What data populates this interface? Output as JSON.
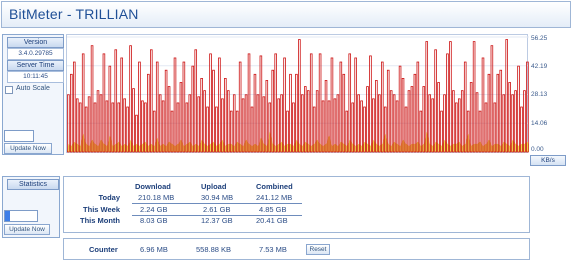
{
  "window": {
    "title": "BitMeter - TRILLIAN"
  },
  "sidebar": {
    "version_label": "Version",
    "version_value": "3.4.0.29785",
    "server_time_label": "Server Time",
    "server_time_value": "10:11:45",
    "auto_scale_label": "Auto Scale",
    "auto_scale_checked": false,
    "update_now_label": "Update Now",
    "progress_fraction": 0.0
  },
  "stats_sidebar": {
    "statistics_label": "Statistics",
    "update_now_label": "Update Now",
    "progress_fraction": 0.15
  },
  "chart_data": {
    "type": "bar",
    "ytick_labels": [
      "56.25",
      "42.19",
      "28.13",
      "14.06",
      "0.00"
    ],
    "ylim": [
      0,
      56.25
    ],
    "units_label": "KB/s",
    "series": [
      {
        "color": "#cc1111",
        "values": [
          28,
          38,
          44,
          26,
          24,
          48,
          22,
          27,
          52,
          24,
          30,
          28,
          48,
          25,
          42,
          24,
          50,
          24,
          46,
          26,
          22,
          52,
          31,
          18,
          44,
          25,
          24,
          38,
          50,
          20,
          44,
          28,
          25,
          40,
          32,
          20,
          46,
          24,
          34,
          44,
          24,
          28,
          42,
          50,
          27,
          36,
          30,
          22,
          48,
          40,
          22,
          46,
          26,
          36,
          30,
          20,
          28,
          20,
          44,
          26,
          28,
          48,
          22,
          38,
          28,
          47,
          27,
          35,
          24,
          40,
          48,
          26,
          28,
          46,
          20,
          38,
          24,
          38,
          55,
          28,
          32,
          30,
          48,
          22,
          30,
          48,
          25,
          35,
          25,
          46,
          26,
          28,
          44,
          38,
          20,
          48,
          24,
          46,
          28,
          25,
          22,
          32,
          47,
          26,
          35,
          28,
          44,
          22,
          40,
          30,
          28,
          25,
          42,
          36,
          22,
          30,
          32,
          38,
          44,
          20,
          32,
          54,
          28,
          26,
          50,
          34,
          20,
          28,
          48,
          54,
          30,
          24,
          26,
          30,
          44,
          20,
          34,
          54,
          29,
          20,
          46,
          24,
          38,
          52,
          24,
          38,
          40,
          28,
          55,
          34,
          28,
          30,
          42,
          22,
          30,
          44
        ]
      },
      {
        "color": "#f0e85a",
        "values": [
          4,
          3,
          5,
          4,
          3,
          9,
          4,
          3,
          6,
          4,
          3,
          6,
          4,
          3,
          8,
          3,
          4,
          5,
          3,
          4,
          3,
          6,
          3,
          4,
          3,
          4,
          5,
          3,
          4,
          3,
          7,
          3,
          4,
          3,
          5,
          4,
          3,
          4,
          6,
          3,
          4,
          5,
          3,
          4,
          3,
          6,
          4,
          3,
          4,
          5,
          3,
          4,
          6,
          3,
          4,
          4,
          3,
          5,
          4,
          3,
          6,
          4,
          3,
          4,
          3,
          7,
          4,
          3,
          10,
          4,
          3,
          4,
          5,
          3,
          4,
          4,
          3,
          6,
          4,
          3,
          5,
          4,
          3,
          4,
          6,
          4,
          3,
          4,
          8,
          3,
          4,
          3,
          5,
          4,
          3,
          6,
          4,
          3,
          4,
          3,
          5,
          4,
          3,
          6,
          4,
          3,
          4,
          9,
          4,
          3,
          5,
          4,
          3,
          6,
          4,
          3,
          4,
          4,
          5,
          3,
          4,
          10,
          4,
          3,
          5,
          4,
          3,
          6,
          4,
          3,
          4,
          4,
          5,
          3,
          4,
          9,
          3,
          4,
          4,
          5,
          3,
          4,
          6,
          3,
          4,
          4,
          3,
          5,
          4,
          3,
          6,
          4,
          3,
          4,
          4,
          5,
          3
        ]
      }
    ]
  },
  "stats": {
    "columns": [
      "Download",
      "Upload",
      "Combined"
    ],
    "rows": [
      {
        "label": "Today",
        "download": "210.18 MB",
        "upload": "30.94 MB",
        "combined": "241.12 MB"
      },
      {
        "label": "This Week",
        "download": "2.24 GB",
        "upload": "2.61 GB",
        "combined": "4.85 GB"
      },
      {
        "label": "This Month",
        "download": "8.03 GB",
        "upload": "12.37 GB",
        "combined": "20.41 GB"
      }
    ]
  },
  "counter": {
    "label": "Counter",
    "download": "6.96 MB",
    "upload": "558.88 KB",
    "combined": "7.53 MB",
    "reset_label": "Reset"
  }
}
